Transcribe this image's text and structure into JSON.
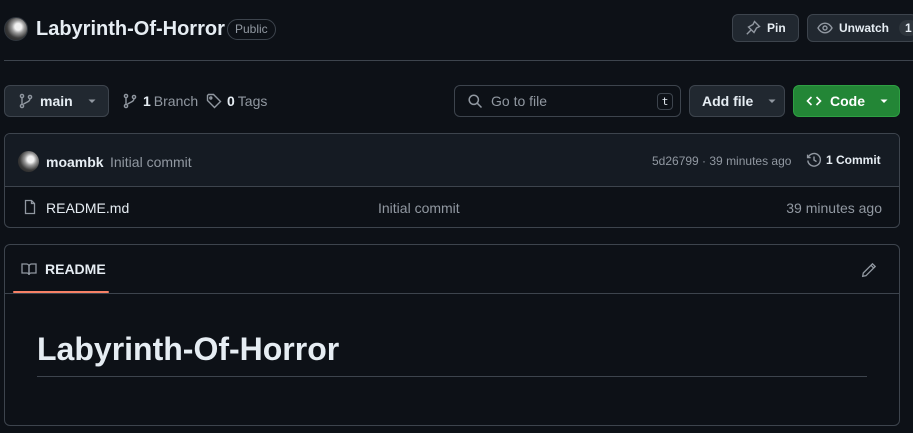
{
  "repo": {
    "name": "Labyrinth-Of-Horror",
    "visibility": "Public"
  },
  "header_actions": {
    "pin_label": "Pin",
    "unwatch_label": "Unwatch",
    "watch_count": "1"
  },
  "toolbar": {
    "branch": "main",
    "branch_count": "1",
    "branch_word": "Branch",
    "tag_count": "0",
    "tag_word": "Tags",
    "search_placeholder": "Go to file",
    "search_shortcut": "t",
    "add_file_label": "Add file",
    "code_label": "Code"
  },
  "latest_commit": {
    "author": "moambk",
    "message": "Initial commit",
    "meta": "5d26799 · 39 minutes ago",
    "count_label": "1 Commit"
  },
  "files": [
    {
      "name": "README.md",
      "commit": "Initial commit",
      "time": "39 minutes ago"
    }
  ],
  "readme": {
    "tab_label": "README",
    "heading": "Labyrinth-Of-Horror"
  },
  "colors": {
    "background": "#0d1117",
    "accent_green": "#238636",
    "tab_underline": "#f78166",
    "border": "#3d444d"
  }
}
